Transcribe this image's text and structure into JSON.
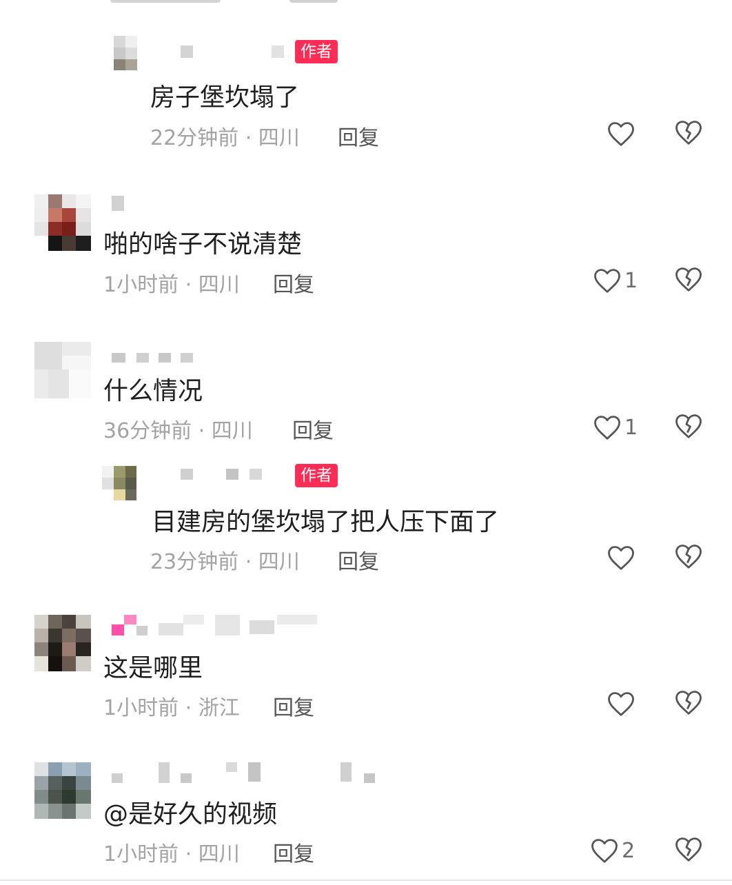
{
  "comments": [
    {
      "author_badge": "作者",
      "text": "房子堡坎塌了",
      "time": "22分钟前",
      "location": "四川",
      "reply_label": "回复",
      "likes": ""
    },
    {
      "author_badge": "",
      "text": "啪的啥子不说清楚",
      "time": "1小时前",
      "location": "四川",
      "reply_label": "回复",
      "likes": "1"
    },
    {
      "author_badge": "",
      "text": "什么情况",
      "time": "36分钟前",
      "location": "四川",
      "reply_label": "回复",
      "likes": "1"
    },
    {
      "author_badge": "作者",
      "text": "目建房的堡坎塌了把人压下面了",
      "time": "23分钟前",
      "location": "四川",
      "reply_label": "回复",
      "likes": ""
    },
    {
      "author_badge": "",
      "text": "这是哪里",
      "time": "1小时前",
      "location": "浙江",
      "reply_label": "回复",
      "likes": ""
    },
    {
      "author_badge": "",
      "text": "@是好久的视频",
      "time": "1小时前",
      "location": "四川",
      "reply_label": "回复",
      "likes": "2"
    }
  ],
  "meta_separator": " · ",
  "icons": {
    "like": "heart-outline-icon",
    "dislike": "broken-heart-icon"
  },
  "colors": {
    "author_badge": "#ff2d55",
    "meta_text": "#a3a3a3",
    "body_text": "#1f1f1f"
  }
}
